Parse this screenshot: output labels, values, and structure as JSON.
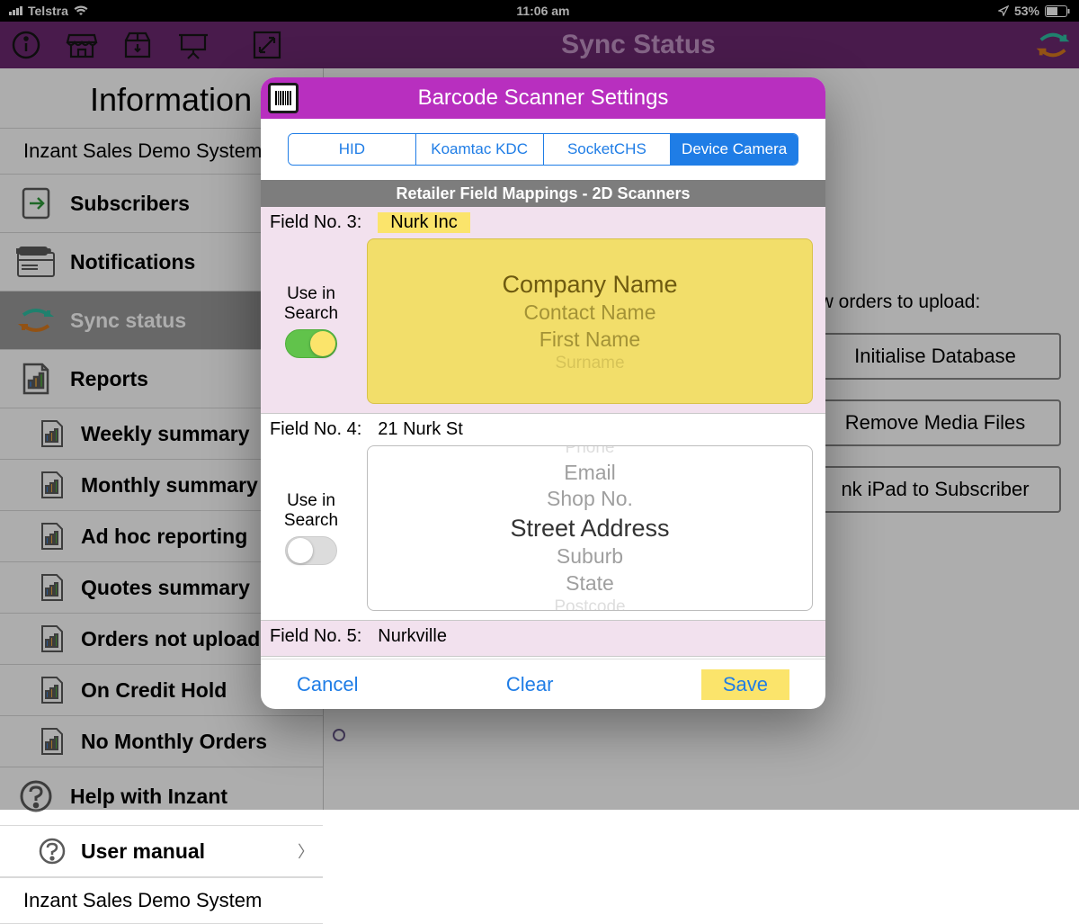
{
  "statusbar": {
    "carrier": "Telstra",
    "time": "11:06 am",
    "battery": "53%"
  },
  "topnav": {
    "title": "Sync Status"
  },
  "page_title": "Information",
  "subtitle": "Inzant Sales Demo System",
  "sidebar": [
    {
      "label": "Subscribers"
    },
    {
      "label": "Notifications"
    },
    {
      "label": "Sync status"
    },
    {
      "label": "Reports"
    },
    {
      "label": "Weekly summary"
    },
    {
      "label": "Monthly summary"
    },
    {
      "label": "Ad hoc reporting"
    },
    {
      "label": "Quotes summary"
    },
    {
      "label": "Orders not uploaded"
    },
    {
      "label": "On Credit Hold"
    },
    {
      "label": "No Monthly Orders"
    },
    {
      "label": "Help with Inzant"
    },
    {
      "label": "User manual"
    }
  ],
  "footer_subtitle": "Inzant Sales Demo System",
  "mainpane": {
    "orders_hint": "ew orders to upload:",
    "buttons": [
      "Initialise Database",
      "Remove Media Files",
      "nk iPad to Subscriber"
    ]
  },
  "modal": {
    "title": "Barcode Scanner Settings",
    "tabs": [
      "HID",
      "Koamtac KDC",
      "SocketCHS",
      "Device Camera"
    ],
    "active_tab": 3,
    "section_header": "Retailer Field Mappings - 2D Scanners",
    "use_in_search_label": "Use in Search",
    "field3": {
      "label": "Field No. 3:",
      "value": "Nurk Inc",
      "toggle": true,
      "options": [
        "Company Name",
        "Contact Name",
        "First Name",
        "Surname"
      ],
      "selected": 0
    },
    "field4": {
      "label": "Field No. 4:",
      "value": "21 Nurk St",
      "toggle": false,
      "options": [
        "Phone",
        "Email",
        "Shop No.",
        "Street Address",
        "Suburb",
        "State",
        "Postcode"
      ],
      "selected": 3
    },
    "field5": {
      "label": "Field No. 5:",
      "value": "Nurkville"
    },
    "footer": {
      "cancel": "Cancel",
      "clear": "Clear",
      "save": "Save"
    }
  }
}
